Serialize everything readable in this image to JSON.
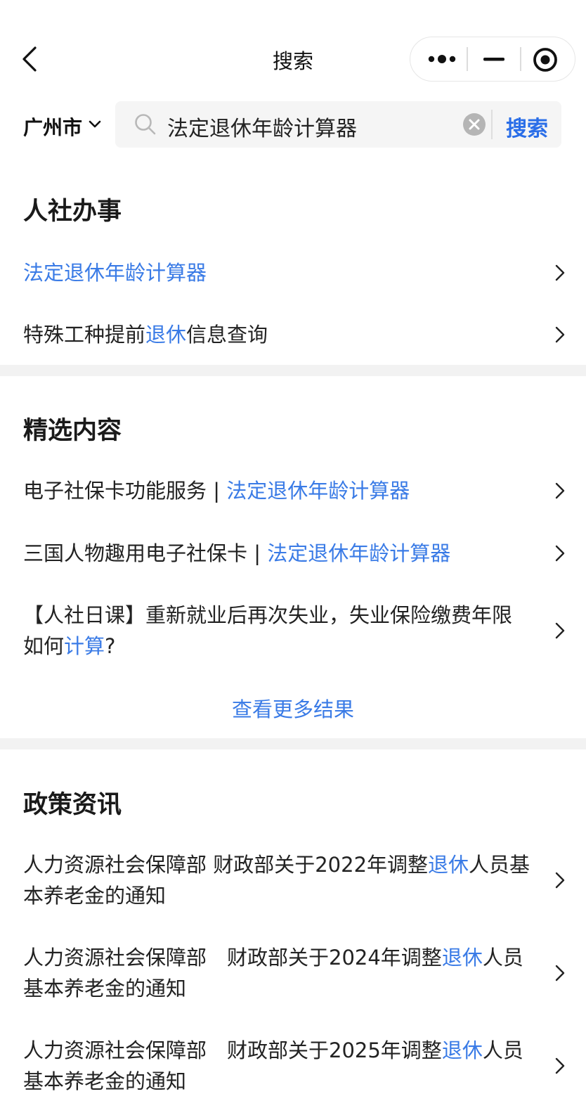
{
  "nav": {
    "title": "搜索"
  },
  "search": {
    "city": "广州市",
    "query": "法定退休年龄计算器",
    "button": "搜索"
  },
  "sections": {
    "services": {
      "title": "人社办事",
      "items": [
        {
          "pre": "",
          "hl": "法定退休年龄计算器",
          "post": ""
        },
        {
          "pre": "特殊工种提前",
          "hl": "退休",
          "post": "信息查询"
        }
      ]
    },
    "featured": {
      "title": "精选内容",
      "items": [
        {
          "pre": "电子社保卡功能服务 | ",
          "hl": "法定退休年龄计算器",
          "post": ""
        },
        {
          "pre": "三国人物趣用电子社保卡 | ",
          "hl": "法定退休年龄计算器",
          "post": ""
        },
        {
          "line1": "【人社日课】重新就业后再次失业，失业保险缴费年限",
          "pre": "如何",
          "hl": "计算",
          "post": "?"
        }
      ],
      "more": "查看更多结果"
    },
    "policy": {
      "title": "政策资讯",
      "items": [
        {
          "pre": "人力资源社会保障部 财政部关于2022年调整",
          "hl": "退休",
          "post": "人员基",
          "line2": "本养老金的通知"
        },
        {
          "pre": "人力资源社会保障部　财政部关于2024年调整",
          "hl": "退休",
          "post": "人员",
          "line2": "基本养老金的通知"
        },
        {
          "pre": "人力资源社会保障部　财政部关于2025年调整",
          "hl": "退休",
          "post": "人员",
          "line2": "基本养老金的通知"
        }
      ]
    }
  },
  "colors": {
    "accent": "#3a7be6",
    "button": "#2a6ee8",
    "divider": "#f2f2f2"
  }
}
